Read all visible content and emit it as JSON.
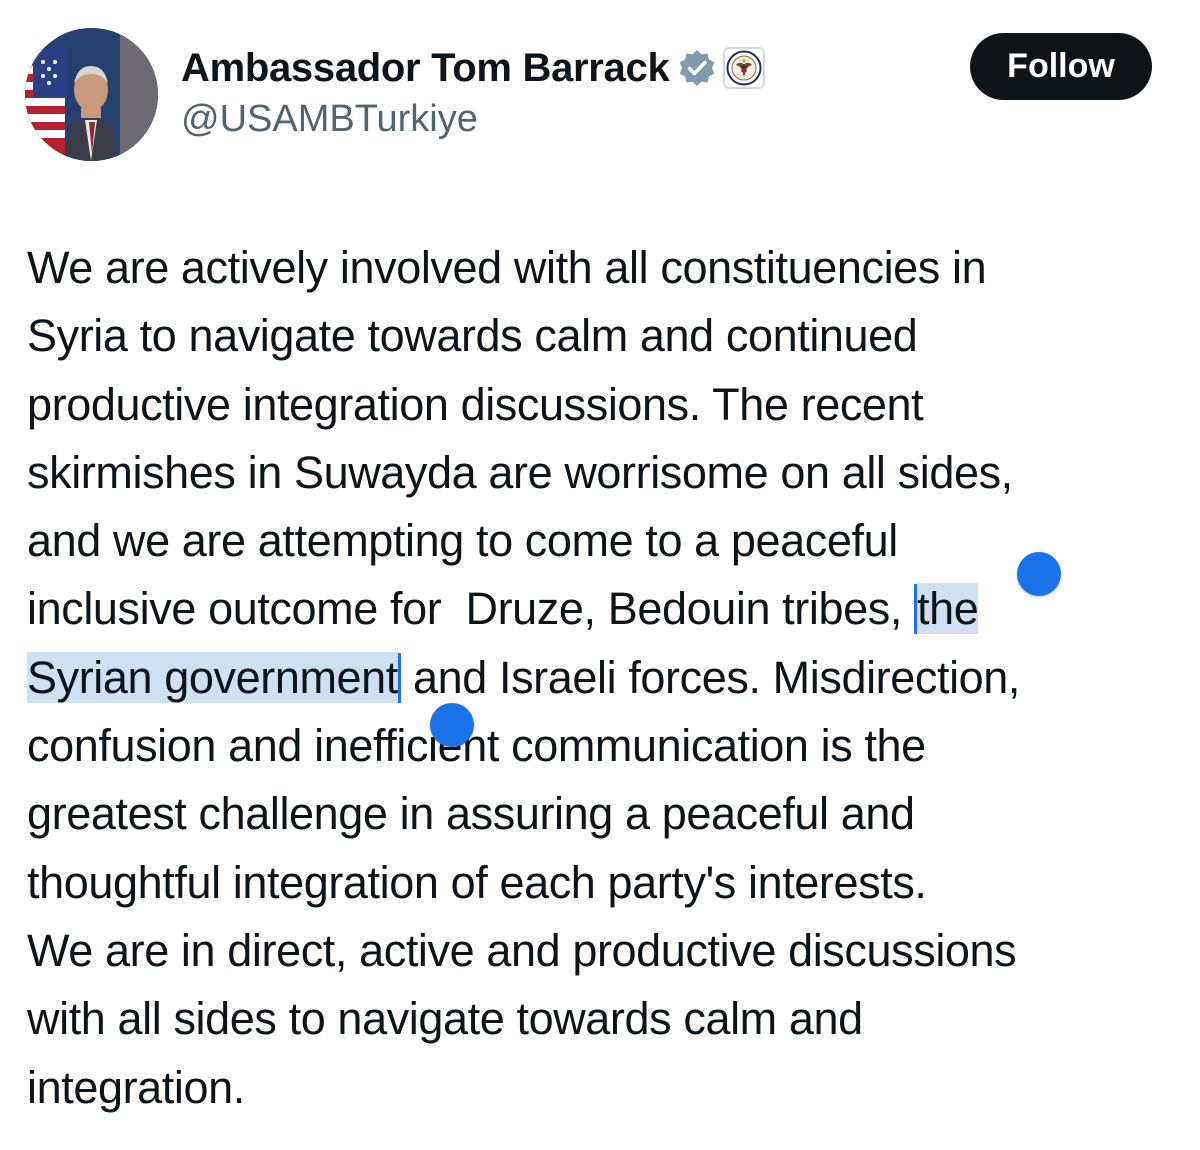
{
  "profile": {
    "display_name": "Ambassador Tom Barrack",
    "handle": "@USAMBTurkiye",
    "avatar_alt": "avatar",
    "verified_icon": "verified-badge-icon",
    "affiliation_icon": "us-state-department-seal-icon"
  },
  "actions": {
    "follow_label": "Follow"
  },
  "tweet": {
    "lines": [
      "We are actively involved with all constituencies in",
      "Syria to navigate towards calm and continued",
      "productive integration discussions. The recent",
      "skirmishes in Suwayda are worrisome on all sides,",
      "and we are attempting to come to a peaceful",
      "inclusive outcome for  Druze, Bedouin tribes, ",
      "the",
      "Syrian government",
      " and Israeli forces. Misdirection,",
      "confusion and inefficient communication is the",
      "greatest challenge in assuring a peaceful and",
      "thoughtful integration of each party's interests.",
      "We are in direct, active and productive discussions",
      "with all sides to navigate towards calm and",
      "integration."
    ],
    "selection": "the Syrian government"
  },
  "colors": {
    "text": "#0f1419",
    "secondary_text": "#536471",
    "follow_bg": "#0f1419",
    "selection_highlight": "#cfe0f2",
    "selection_handle": "#1a73e8",
    "verified": "#829aab"
  }
}
